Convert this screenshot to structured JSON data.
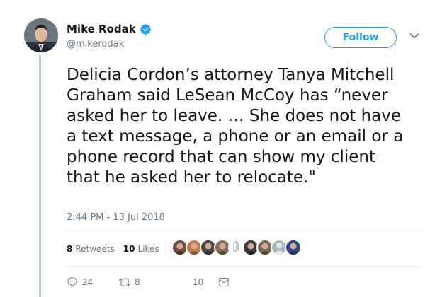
{
  "author": {
    "name": "Mike Rodak",
    "handle": "@mikerodak",
    "verified": true
  },
  "follow_label": "Follow",
  "tweet_text": "Delicia Cordon’s attorney Tanya Mitchell\nGraham said LeSean McCoy has “never\nasked her to leave. … She does not have\na text message, a phone or an email or a\nphone record that can show my client\nthat he asked her to relocate.\"",
  "timestamp": "2:44 PM - 13 Jul 2018",
  "stats": {
    "retweets_count": "8",
    "retweets_label": "Retweets",
    "likes_count": "10",
    "likes_label": "Likes"
  },
  "likers": [
    {
      "icon": "user-avatar",
      "color": "#6b4f3f"
    },
    {
      "icon": "user-avatar",
      "color": "#c27a4a"
    },
    {
      "icon": "user-avatar",
      "color": "#4a4a4a"
    },
    {
      "icon": "user-avatar",
      "color": "#8a6d5a"
    },
    {
      "icon": "paperclip-icon",
      "color": "#b0b0b0"
    },
    {
      "icon": "user-avatar",
      "color": "#3a3a3a"
    },
    {
      "icon": "user-avatar",
      "color": "#7a6a5a"
    },
    {
      "icon": "default-avatar",
      "color": "#aab8c2"
    },
    {
      "icon": "user-avatar",
      "color": "#2a4a8a"
    }
  ],
  "actions": {
    "reply_count": "24",
    "retweet_count": "8",
    "like_count": "10"
  },
  "colors": {
    "accent": "#1da1f2",
    "thread_line": "#a3d4f5",
    "muted": "#657786"
  }
}
